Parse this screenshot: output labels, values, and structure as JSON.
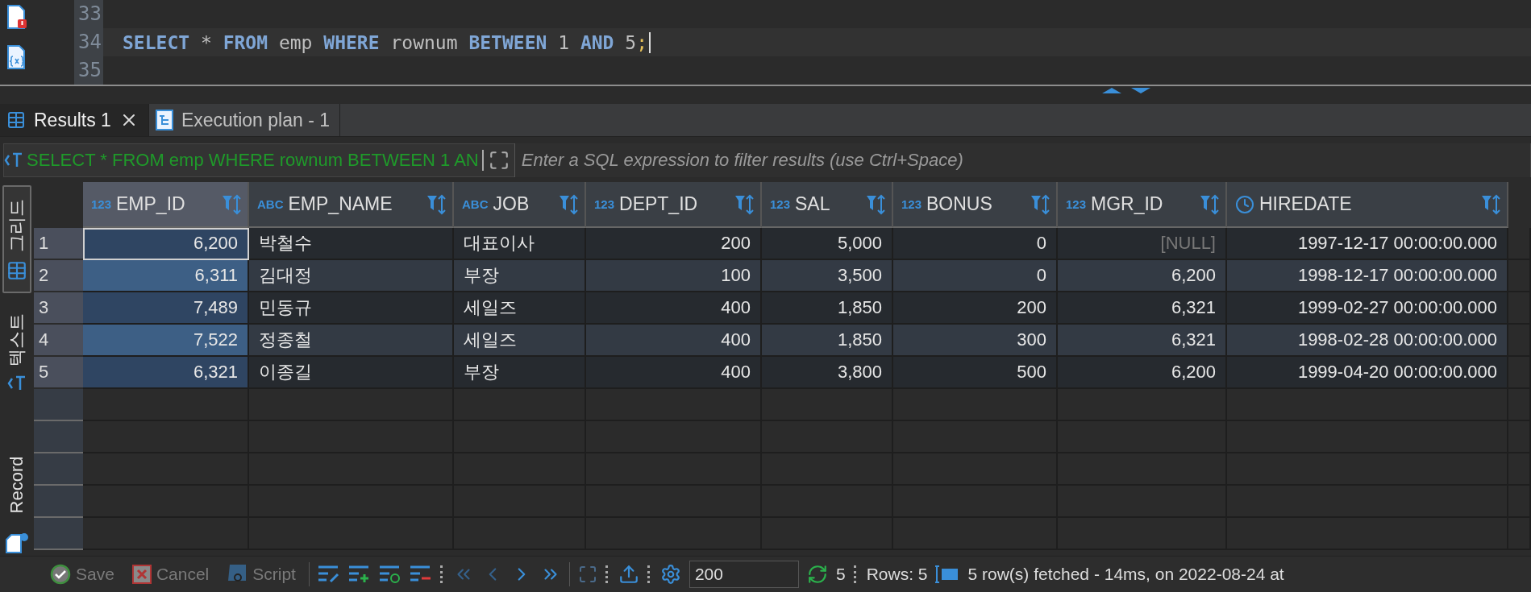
{
  "editor": {
    "lines": [
      {
        "number": "33",
        "current": false
      },
      {
        "number": "34",
        "current": true,
        "tokens": [
          {
            "kind": "keyword",
            "text": "SELECT"
          },
          {
            "kind": "plain",
            "text": "*"
          },
          {
            "kind": "keyword",
            "text": "FROM"
          },
          {
            "kind": "plain",
            "text": "emp"
          },
          {
            "kind": "keyword",
            "text": "WHERE"
          },
          {
            "kind": "plain",
            "text": "rownum"
          },
          {
            "kind": "keyword",
            "text": "BETWEEN"
          },
          {
            "kind": "plain",
            "text": "1"
          },
          {
            "kind": "keyword",
            "text": "AND"
          },
          {
            "kind": "plain",
            "text": "5"
          },
          {
            "kind": "punct",
            "text": ";"
          }
        ]
      },
      {
        "number": "35",
        "current": false
      }
    ]
  },
  "result_tabs": [
    {
      "label": "Results 1",
      "selected": true,
      "closable": true
    },
    {
      "label": "Execution plan - 1",
      "selected": false,
      "closable": false
    }
  ],
  "filter": {
    "query": "SELECT * FROM emp WHERE rownum BETWEEN 1 AN",
    "placeholder": "Enter a SQL expression to filter results (use Ctrl+Space)"
  },
  "view_tabs": [
    {
      "kind": "grid",
      "label": "그리드",
      "selected": true
    },
    {
      "kind": "text",
      "label": "텍스트",
      "selected": false
    },
    {
      "kind": "record",
      "label": "Record",
      "selected": false
    }
  ],
  "table": {
    "columns": [
      {
        "name": "EMP_ID",
        "kind": "number",
        "type_label": "123",
        "selected": true
      },
      {
        "name": "EMP_NAME",
        "kind": "text",
        "type_label": "ABC",
        "selected": false
      },
      {
        "name": "JOB",
        "kind": "text",
        "type_label": "ABC",
        "selected": false
      },
      {
        "name": "DEPT_ID",
        "kind": "number",
        "type_label": "123",
        "selected": false
      },
      {
        "name": "SAL",
        "kind": "number",
        "type_label": "123",
        "selected": false
      },
      {
        "name": "BONUS",
        "kind": "number",
        "type_label": "123",
        "selected": false
      },
      {
        "name": "MGR_ID",
        "kind": "number",
        "type_label": "123",
        "selected": false
      },
      {
        "name": "HIREDATE",
        "kind": "date",
        "selected": false
      }
    ],
    "rows": [
      {
        "number": "1",
        "focused": true,
        "cells": [
          "6,200",
          "박철수",
          "대표이사",
          "200",
          "5,000",
          "0",
          {
            "text": "[NULL]",
            "is_null": true
          },
          "1997-12-17 00:00:00.000"
        ]
      },
      {
        "number": "2",
        "focused": false,
        "cells": [
          "6,311",
          "김대정",
          "부장",
          "100",
          "3,500",
          "0",
          "6,200",
          "1998-12-17 00:00:00.000"
        ]
      },
      {
        "number": "3",
        "focused": false,
        "cells": [
          "7,489",
          "민동규",
          "세일즈",
          "400",
          "1,850",
          "200",
          "6,321",
          "1999-02-27 00:00:00.000"
        ]
      },
      {
        "number": "4",
        "focused": false,
        "cells": [
          "7,522",
          "정종철",
          "세일즈",
          "400",
          "1,850",
          "300",
          "6,321",
          "1998-02-28 00:00:00.000"
        ]
      },
      {
        "number": "5",
        "focused": false,
        "cells": [
          "6,321",
          "이종길",
          "부장",
          "400",
          "3,800",
          "500",
          "6,200",
          "1999-04-20 00:00:00.000"
        ]
      }
    ]
  },
  "toolbar": {
    "actions": [
      {
        "kind": "save",
        "label": "Save",
        "disabled": true
      },
      {
        "kind": "cancel",
        "label": "Cancel",
        "disabled": true
      },
      {
        "kind": "script",
        "label": "Script",
        "disabled": true
      }
    ],
    "fetch_size": "200",
    "refresh_count": "5",
    "rows": "Rows: 5",
    "status": "5 row(s) fetched - 14ms, on 2022-08-24 at"
  }
}
